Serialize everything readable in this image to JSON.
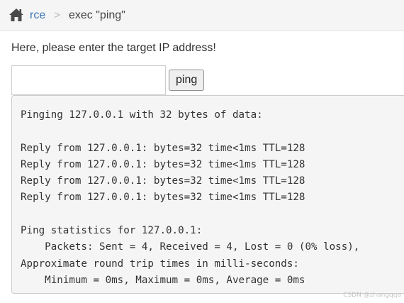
{
  "breadcrumb": {
    "home_icon": "home-icon",
    "link_label": "rce",
    "separator": ">",
    "current": "exec \"ping\""
  },
  "form": {
    "prompt": "Here, please enter the target IP address!",
    "input_value": "",
    "button_label": "ping"
  },
  "output": {
    "lines": [
      "Pinging 127.0.0.1 with 32 bytes of data:",
      "",
      "Reply from 127.0.0.1: bytes=32 time<1ms TTL=128",
      "Reply from 127.0.0.1: bytes=32 time<1ms TTL=128",
      "Reply from 127.0.0.1: bytes=32 time<1ms TTL=128",
      "Reply from 127.0.0.1: bytes=32 time<1ms TTL=128",
      "",
      "Ping statistics for 127.0.0.1:",
      "    Packets: Sent = 4, Received = 4, Lost = 0 (0% loss),",
      "Approximate round trip times in milli-seconds:",
      "    Minimum = 0ms, Maximum = 0ms, Average = 0ms"
    ]
  },
  "watermark": "CSDN @zhangqqa",
  "colors": {
    "link": "#3a74b8",
    "icon": "#4a4a4a",
    "output_bg": "#f5f5f5"
  }
}
